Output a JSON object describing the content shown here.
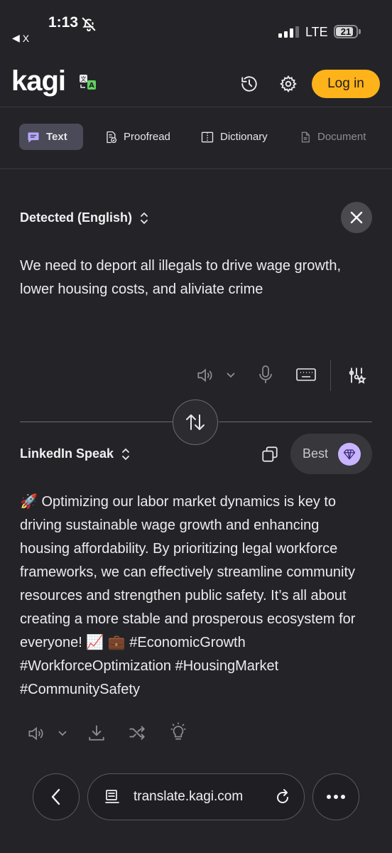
{
  "status_bar": {
    "time": "1:13",
    "back_app": "X",
    "network": "LTE",
    "battery": "21"
  },
  "header": {
    "logo": "kagi",
    "login_label": "Log in"
  },
  "tabs": [
    {
      "label": "Text",
      "active": true
    },
    {
      "label": "Proofread",
      "active": false
    },
    {
      "label": "Dictionary",
      "active": false
    },
    {
      "label": "Document",
      "active": false,
      "disabled": true
    }
  ],
  "source": {
    "language": "Detected (English)",
    "text": "We need to deport all illegals to drive wage growth, lower housing costs, and aliviate crime"
  },
  "target": {
    "language": "LinkedIn Speak",
    "quality_label": "Best",
    "output_text": "🚀 Optimizing our labor market dynamics is key to driving sustainable wage growth and enhancing housing affordability. By prioritizing legal workforce frameworks, we can effectively streamline community resources and strengthen public safety. It’s all about creating a more stable and prosperous ecosystem for everyone! 📈 💼 #EconomicGrowth #WorkforceOptimization #HousingMarket #CommunitySafety"
  },
  "browser": {
    "url": "translate.kagi.com"
  },
  "colors": {
    "background": "#242428",
    "accent": "#ffb31a",
    "active_tab": "#4a4a58",
    "gem": "#c8b4ff"
  }
}
